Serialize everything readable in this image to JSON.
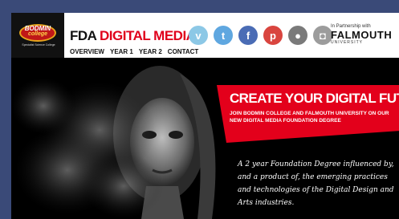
{
  "logo": {
    "name": "BODMIN",
    "sub": "college",
    "tagline": "Specialist Science College"
  },
  "title": {
    "black": "FDA ",
    "red": "DIGITAL MEDIA"
  },
  "nav": [
    "OVERVIEW",
    "YEAR 1",
    "YEAR 2",
    "CONTACT"
  ],
  "socials": [
    {
      "icon": "vimeo-icon",
      "glyph": "v",
      "color": "#8cc8e6"
    },
    {
      "icon": "twitter-icon",
      "glyph": "t",
      "color": "#5fa7e0"
    },
    {
      "icon": "facebook-icon",
      "glyph": "f",
      "color": "#4a6cb5"
    },
    {
      "icon": "pinterest-icon",
      "glyph": "p",
      "color": "#d9453f"
    },
    {
      "icon": "apple-icon",
      "glyph": "●",
      "color": "#7a7a7a"
    },
    {
      "icon": "instagram-icon",
      "glyph": "◘",
      "color": "#9c9c9c"
    }
  ],
  "partner": {
    "label": "In Partnership with",
    "name": "FALMOUTH",
    "sub": "UNIVERSITY"
  },
  "hero": {
    "headline": "CREATE YOUR DIGITAL FUTURE",
    "subheadline": "JOIN BODMIN COLLEGE AND FALMOUTH UNIVERSITY ON OUR NEW DIGITAL MEDIA FOUNDATION DEGREE",
    "script": "A 2 year Foundation Degree influenced by, and a product of, the emerging practices and technologies of the Digital Design and Arts industries."
  },
  "colors": {
    "accent": "#e3001b",
    "background": "#000000"
  }
}
